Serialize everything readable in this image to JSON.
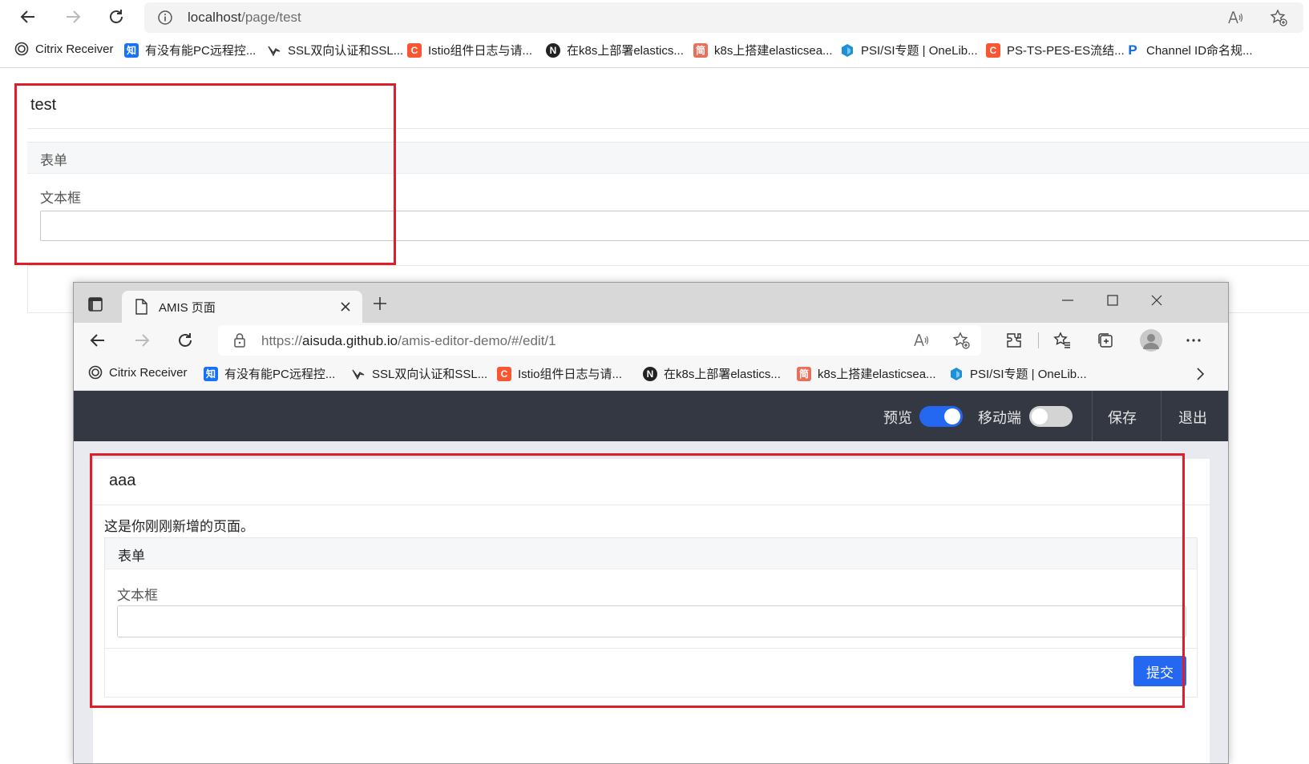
{
  "outer_browser": {
    "address": {
      "host": "localhost",
      "path": "/page/test"
    },
    "bookmarks": [
      {
        "label": "Citrix Receiver",
        "icon": "citrix-icon",
        "color": "#333333"
      },
      {
        "label": "有没有能PC远程控...",
        "icon": "zhihu-icon",
        "glyph": "知",
        "color": "#1772f6"
      },
      {
        "label": "SSL双向认证和SSL...",
        "icon": "bird-icon",
        "color": "#333333"
      },
      {
        "label": "Istio组件日志与请...",
        "icon": "csdn-icon",
        "glyph": "C",
        "color": "#fc5531"
      },
      {
        "label": "在k8s上部署elastics...",
        "icon": "n-icon",
        "glyph": "N",
        "color": "#222222"
      },
      {
        "label": "k8s上搭建elasticsea...",
        "icon": "jianshu-icon",
        "glyph": "简",
        "color": "#ea6f5a"
      },
      {
        "label": "PSI/SI专题 | OneLib...",
        "icon": "onelib-icon",
        "color": "#1e90d6"
      },
      {
        "label": "PS-TS-PES-ES流结...",
        "icon": "csdn-icon",
        "glyph": "C",
        "color": "#fc5531"
      },
      {
        "label": "Channel ID命名规...",
        "icon": "paypal-icon",
        "glyph": "P",
        "color": "#0f6bd7"
      }
    ],
    "page": {
      "title": "test",
      "form_title": "表单",
      "field_label": "文本框",
      "field_value": ""
    }
  },
  "inner_browser": {
    "tab_title": "AMIS 页面",
    "address": {
      "scheme": "https://",
      "host": "aisuda.github.io",
      "path": "/amis-editor-demo/#/edit/1"
    },
    "bookmarks": [
      {
        "label": "Citrix Receiver",
        "icon": "citrix-icon",
        "color": "#333333"
      },
      {
        "label": "有没有能PC远程控...",
        "icon": "zhihu-icon",
        "glyph": "知",
        "color": "#1772f6"
      },
      {
        "label": "SSL双向认证和SSL...",
        "icon": "bird-icon",
        "color": "#333333"
      },
      {
        "label": "Istio组件日志与请...",
        "icon": "csdn-icon",
        "glyph": "C",
        "color": "#fc5531"
      },
      {
        "label": "在k8s上部署elastics...",
        "icon": "n-icon",
        "glyph": "N",
        "color": "#222222"
      },
      {
        "label": "k8s上搭建elasticsea...",
        "icon": "jianshu-icon",
        "glyph": "简",
        "color": "#ea6f5a"
      },
      {
        "label": "PSI/SI专题 | OneLib...",
        "icon": "onelib-icon",
        "color": "#1e90d6"
      }
    ],
    "app_header": {
      "preview_label": "预览",
      "preview_on": true,
      "mobile_label": "移动端",
      "mobile_on": false,
      "save_label": "保存",
      "exit_label": "退出"
    },
    "page": {
      "title": "aaa",
      "description": "这是你刚刚新增的页面。",
      "form_title": "表单",
      "field_label": "文本框",
      "field_value": "",
      "submit_label": "提交"
    }
  },
  "colors": {
    "highlight_frame": "#e01e2b",
    "header_bg": "#333842",
    "switch_on": "#2468f2",
    "switch_off": "#d4d4d4",
    "submit_bg": "#2468f2"
  }
}
